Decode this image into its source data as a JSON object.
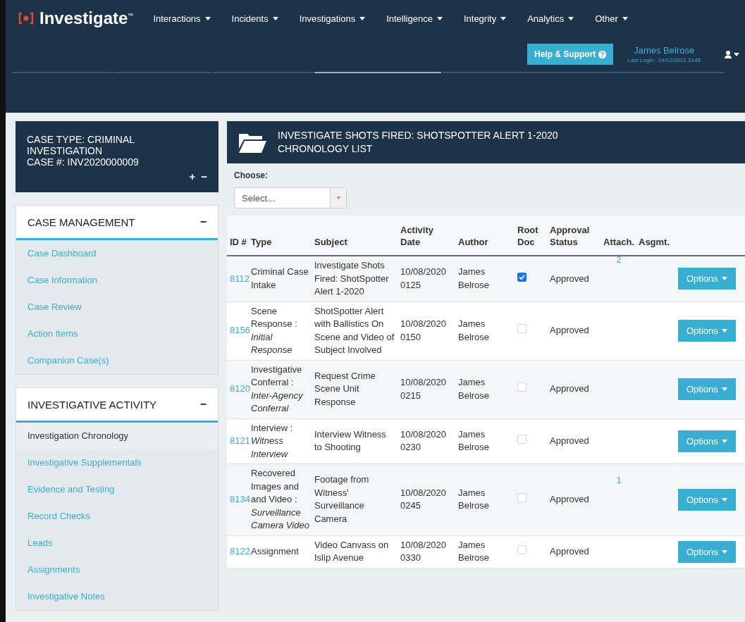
{
  "brand": {
    "name": "Investigate",
    "mark": "™"
  },
  "nav": [
    {
      "label": "Interactions"
    },
    {
      "label": "Incidents"
    },
    {
      "label": "Investigations"
    },
    {
      "label": "Intelligence"
    },
    {
      "label": "Integrity"
    },
    {
      "label": "Analytics"
    },
    {
      "label": "Other"
    }
  ],
  "help_button": "Help & Support",
  "user": {
    "name": "James Belrose",
    "last_login": "Last Login : 04/12/2021 2145"
  },
  "case_header": {
    "lines": [
      "CASE TYPE: CRIMINAL INVESTIGATION",
      "CASE #: INV2020000009"
    ],
    "expand": "+",
    "collapse": "−"
  },
  "sections": [
    {
      "title": "CASE MANAGEMENT",
      "toggle": "−",
      "items": [
        {
          "label": "Case Dashboard",
          "selected": false
        },
        {
          "label": "Case Information",
          "selected": false
        },
        {
          "label": "Case Review",
          "selected": false
        },
        {
          "label": "Action Items",
          "selected": false
        },
        {
          "label": "Companion Case(s)",
          "selected": false
        }
      ]
    },
    {
      "title": "INVESTIGATIVE ACTIVITY",
      "toggle": "−",
      "items": [
        {
          "label": "Investigation Chronology",
          "selected": true
        },
        {
          "label": "Investigative Supplementals",
          "selected": false
        },
        {
          "label": "Evidence and Testing",
          "selected": false
        },
        {
          "label": "Record Checks",
          "selected": false
        },
        {
          "label": "Leads",
          "selected": false
        },
        {
          "label": "Assignments",
          "selected": false
        },
        {
          "label": "Investigative Notes",
          "selected": false
        }
      ]
    }
  ],
  "panel": {
    "title_lines": [
      "INVESTIGATE SHOTS FIRED: SHOTSPOTTER ALERT 1-2020",
      "CHRONOLOGY LIST"
    ],
    "choose_label": "Choose:",
    "select_placeholder": "Select..."
  },
  "table": {
    "columns": [
      "ID #",
      "Type",
      "Subject",
      "Activity Date",
      "Author",
      "Root Doc",
      "Approval Status",
      "Attach.",
      "Asgmt."
    ],
    "rows": [
      {
        "id": "8112",
        "type": "Criminal Case Intake",
        "subject": "Investigate Shots Fired: ShotSpotter Alert 1-2020",
        "date": "10/08/2020 0125",
        "author": "James Belrose",
        "root_doc": true,
        "status": "Approved",
        "attach": "2",
        "options": "Options"
      },
      {
        "id": "8156",
        "type": "Scene Response : *Initial Response*",
        "subject": "ShotSpotter Alert with Ballistics On Scene and Video of Subject Involved",
        "date": "10/08/2020 0150",
        "author": "James Belrose",
        "root_doc": false,
        "status": "Approved",
        "options": "Options"
      },
      {
        "id": "8120",
        "type": "Investigative Conferral : *Inter-Agency Conferral*",
        "subject": "Request Crime Scene Unit Response",
        "date": "10/08/2020 0215",
        "author": "James Belrose",
        "root_doc": false,
        "status": "Approved",
        "options": "Options"
      },
      {
        "id": "8121",
        "type": "Interview : *Witness Interview*",
        "subject": "Interview Witness to Shooting",
        "date": "10/08/2020 0230",
        "author": "James Belrose",
        "root_doc": false,
        "status": "Approved",
        "options": "Options"
      },
      {
        "id": "8134",
        "type": "Recovered Images and and Video : *Surveillance Camera Video*",
        "subject": "Footage from Witness' Surveillance Camera",
        "date": "10/08/2020 0245",
        "author": "James Belrose",
        "root_doc": false,
        "status": "Approved",
        "attach": "1",
        "options": "Options"
      },
      {
        "id": "8122",
        "type": "Assignment",
        "subject": "Video Canvass on Islip Avenue",
        "date": "10/08/2020 0330",
        "author": "James Belrose",
        "root_doc": false,
        "status": "Approved",
        "options": "Options"
      }
    ]
  }
}
